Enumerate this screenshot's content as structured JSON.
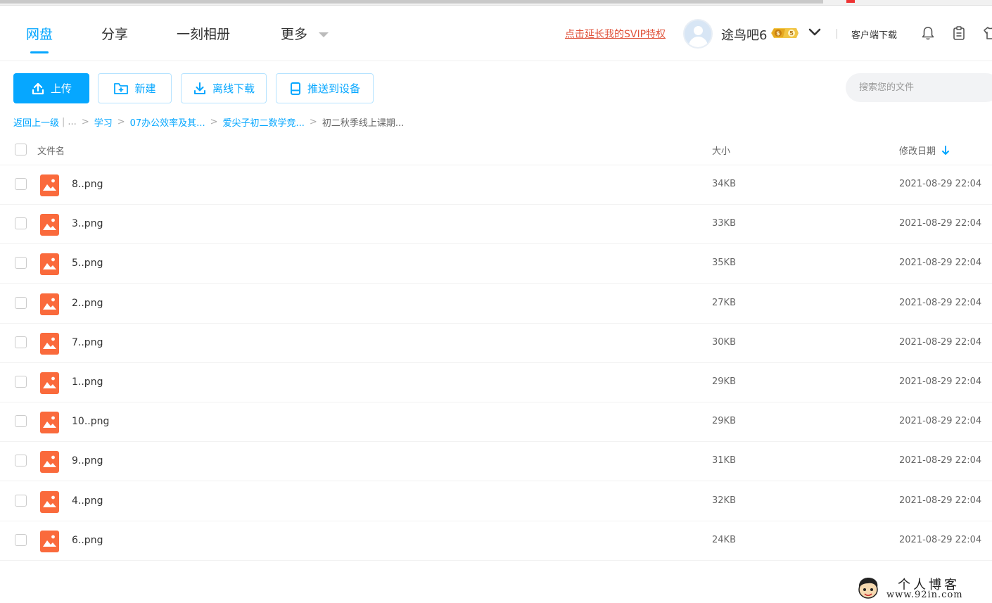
{
  "nav": {
    "tabs": [
      {
        "label": "网盘",
        "active": true
      },
      {
        "label": "分享"
      },
      {
        "label": "一刻相册"
      },
      {
        "label": "更多"
      }
    ],
    "svip_link": "点击延长我的SVIP特权",
    "username": "途鸟吧6",
    "client_download": "客户端下载"
  },
  "toolbar": {
    "upload": "上传",
    "new": "新建",
    "offline_download": "离线下载",
    "push_to_device": "推送到设备",
    "search_placeholder": "搜索您的文件"
  },
  "breadcrumb": {
    "back": "返回上一级",
    "separator": "|",
    "ellipsis": "...",
    "items": [
      "学习",
      "07办公效率及其...",
      "爱尖子初二数学竞...",
      "初二秋季线上课期..."
    ]
  },
  "table": {
    "headers": {
      "name": "文件名",
      "size": "大小",
      "date": "修改日期"
    },
    "sort": {
      "column": "date",
      "direction": "desc"
    },
    "rows": [
      {
        "name": "8..png",
        "size": "34KB",
        "date": "2021-08-29 22:04"
      },
      {
        "name": "3..png",
        "size": "33KB",
        "date": "2021-08-29 22:04"
      },
      {
        "name": "5..png",
        "size": "35KB",
        "date": "2021-08-29 22:04"
      },
      {
        "name": "2..png",
        "size": "27KB",
        "date": "2021-08-29 22:04"
      },
      {
        "name": "7..png",
        "size": "30KB",
        "date": "2021-08-29 22:04"
      },
      {
        "name": "1..png",
        "size": "29KB",
        "date": "2021-08-29 22:04"
      },
      {
        "name": "10..png",
        "size": "29KB",
        "date": "2021-08-29 22:04"
      },
      {
        "name": "9..png",
        "size": "31KB",
        "date": "2021-08-29 22:04"
      },
      {
        "name": "4..png",
        "size": "32KB",
        "date": "2021-08-29 22:04"
      },
      {
        "name": "6..png",
        "size": "24KB",
        "date": "2021-08-29 22:04"
      }
    ]
  },
  "watermark": {
    "title": "个人博客",
    "url": "www.92in.com"
  },
  "colors": {
    "accent": "#06a7ff",
    "svip_link": "#e0533b",
    "file_icon": "#fa6a3c"
  },
  "icons": {
    "upload": "upload-icon",
    "new": "new-folder-icon",
    "offline": "download-icon",
    "push": "device-icon",
    "bell": "bell-icon",
    "clipboard": "clipboard-icon",
    "shirt": "shirt-icon",
    "file": "image-file-icon",
    "sort": "arrow-down-icon"
  }
}
